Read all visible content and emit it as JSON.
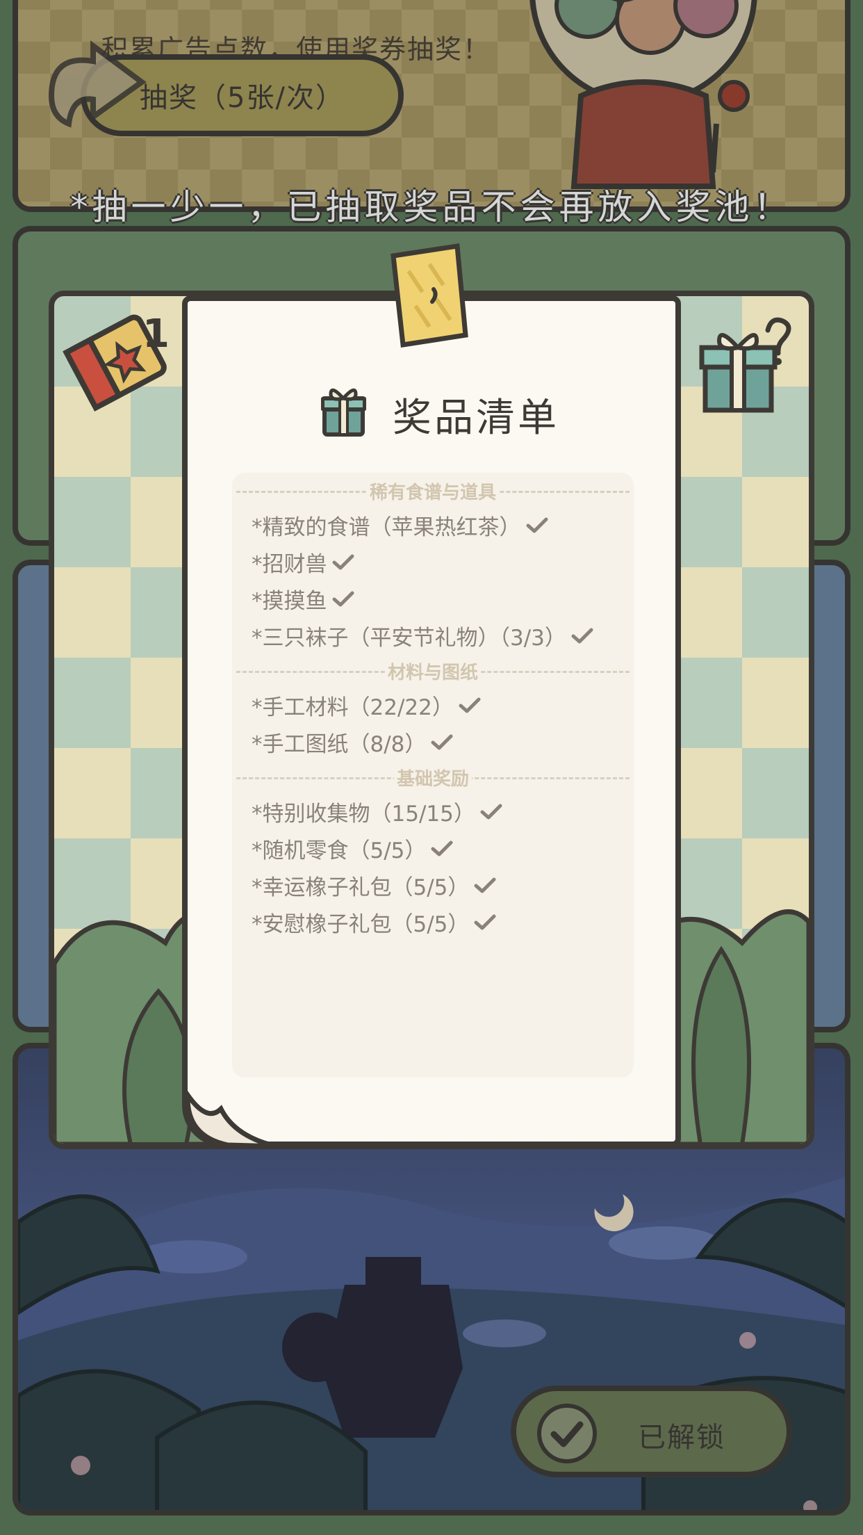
{
  "lottery": {
    "subtitle": "积累广告点数，使用奖券抽奖！",
    "draw_button": "抽奖（5张/次）",
    "notice": "*抽一少一，已抽取奖品不会再放入奖池！"
  },
  "modal": {
    "ticket_count": "1",
    "title": "奖品清单",
    "sections": [
      {
        "heading": "稀有食谱与道具",
        "items": [
          {
            "text": "*精致的食谱（苹果热红茶）",
            "checked": true
          },
          {
            "text": "*招财兽",
            "checked": true
          },
          {
            "text": "*摸摸鱼",
            "checked": true
          },
          {
            "text": "*三只袜子（平安节礼物）（3/3）",
            "checked": true
          }
        ]
      },
      {
        "heading": "材料与图纸",
        "items": [
          {
            "text": "*手工材料（22/22）",
            "checked": true
          },
          {
            "text": "*手工图纸（8/8）",
            "checked": true
          }
        ]
      },
      {
        "heading": "基础奖励",
        "items": [
          {
            "text": "*特别收集物（15/15）",
            "checked": true
          },
          {
            "text": "*随机零食（5/5）",
            "checked": true
          },
          {
            "text": "*幸运橡子礼包（5/5）",
            "checked": true
          },
          {
            "text": "*安慰橡子礼包（5/5）",
            "checked": true
          }
        ]
      }
    ]
  },
  "unlocked_button": {
    "label": "已解锁"
  },
  "colors": {
    "outline": "#3d3a36",
    "paper": "#fcf9f3",
    "item_text": "#8a827a",
    "section_text": "#d2c6ae"
  }
}
